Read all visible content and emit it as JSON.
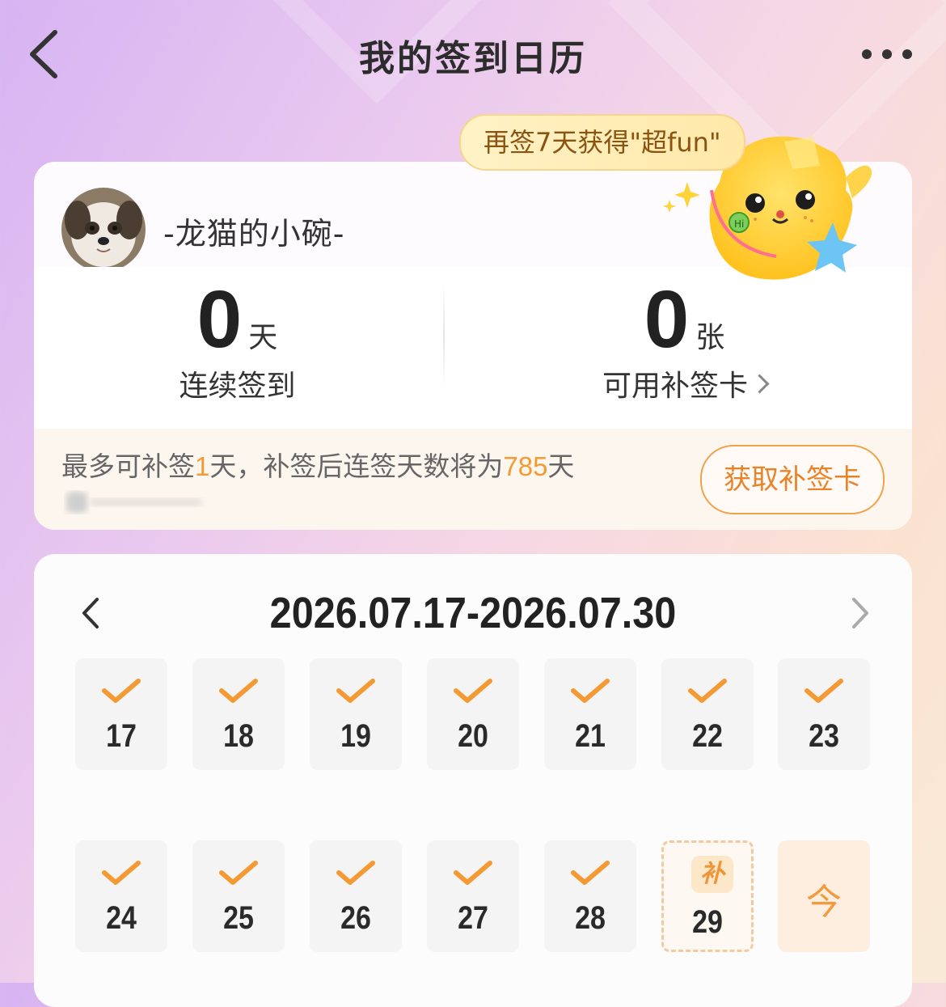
{
  "header": {
    "title": "我的签到日历"
  },
  "reward_tip": "再签7天获得\"超fun\"",
  "user": {
    "name": "-龙猫的小碗-"
  },
  "stats": {
    "streak": {
      "value": "0",
      "unit": "天",
      "label": "连续签到"
    },
    "cards": {
      "value": "0",
      "unit": "张",
      "label": "可用补签卡"
    }
  },
  "makeup": {
    "text_prefix": "最多可补签",
    "days": "1",
    "text_mid": "天，补签后连签天数将为",
    "result_days": "785",
    "text_suffix": "天",
    "button_label": "获取补签卡"
  },
  "calendar": {
    "range": "2026.07.17-2026.07.30",
    "days": [
      {
        "day": "17",
        "state": "checked"
      },
      {
        "day": "18",
        "state": "checked"
      },
      {
        "day": "19",
        "state": "checked"
      },
      {
        "day": "20",
        "state": "checked"
      },
      {
        "day": "21",
        "state": "checked"
      },
      {
        "day": "22",
        "state": "checked"
      },
      {
        "day": "23",
        "state": "checked"
      },
      {
        "day": "24",
        "state": "checked"
      },
      {
        "day": "25",
        "state": "checked"
      },
      {
        "day": "26",
        "state": "checked"
      },
      {
        "day": "27",
        "state": "checked"
      },
      {
        "day": "28",
        "state": "checked"
      },
      {
        "day": "29",
        "state": "makeup",
        "badge": "补"
      },
      {
        "day": "",
        "state": "today",
        "label": "今"
      }
    ]
  },
  "colors": {
    "accent": "#f39a35",
    "check": "#f39a35",
    "title": "#2c2c2c"
  }
}
